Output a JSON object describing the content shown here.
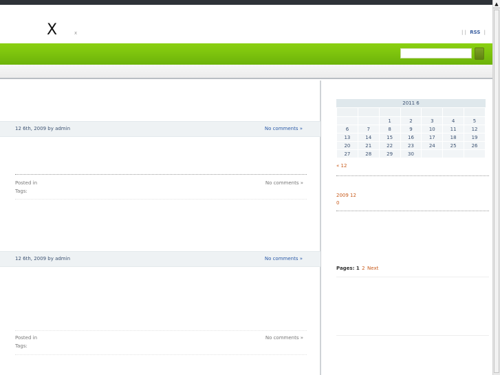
{
  "header": {
    "logo": "X",
    "tagline": "x",
    "links_sep_left": "|",
    "links_sep_mid": "|",
    "rss": "RSS",
    "links_sep_right": "|"
  },
  "search": {
    "value": "",
    "placeholder": ""
  },
  "posts": [
    {
      "date_line": "12  6th, 2009 by admin",
      "comments_link": "No comments »",
      "posted_in": "Posted in",
      "tags": "Tags:",
      "footer_comments": "No comments »"
    },
    {
      "date_line": "12  6th, 2009 by admin",
      "comments_link": "No comments »",
      "posted_in": "Posted in",
      "tags": "Tags:",
      "footer_comments": "No comments »"
    }
  ],
  "sidebar": {
    "calendar": {
      "caption": "2011 6",
      "weeks": [
        [
          "",
          "",
          "1",
          "2",
          "3",
          "4",
          "5"
        ],
        [
          "6",
          "7",
          "8",
          "9",
          "10",
          "11",
          "12"
        ],
        [
          "13",
          "14",
          "15",
          "16",
          "17",
          "18",
          "19"
        ],
        [
          "20",
          "21",
          "22",
          "23",
          "24",
          "25",
          "26"
        ],
        [
          "27",
          "28",
          "29",
          "30",
          "",
          "",
          ""
        ]
      ],
      "prev_link": "« 12"
    },
    "archive": {
      "month": "2009 12",
      "count": "0"
    },
    "pagination": {
      "label": "Pages:",
      "current": "1",
      "next_page": "2",
      "next": "Next"
    }
  },
  "colors": {
    "accent_green": "#7cc20f",
    "link_orange": "#c85a1a",
    "link_blue": "#2a5aa8",
    "top_bar": "#2e3238"
  }
}
